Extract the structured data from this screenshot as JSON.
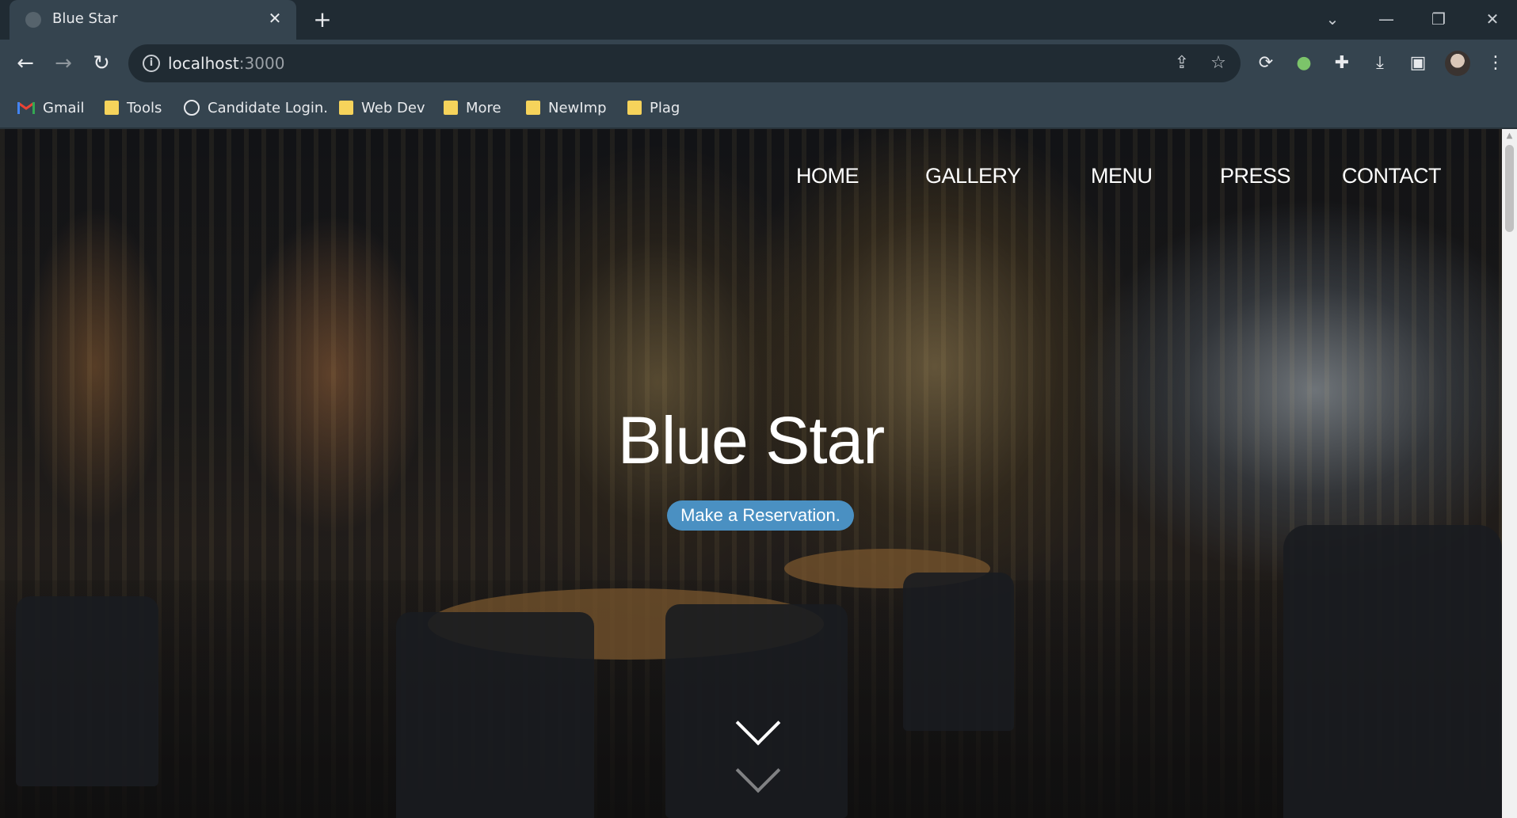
{
  "browser": {
    "tab_title": "Blue Star",
    "url_host": "localhost",
    "url_port": ":3000",
    "bookmarks": [
      {
        "label": "Gmail",
        "icon": "gmail-icon"
      },
      {
        "label": "Tools",
        "icon": "folder-icon"
      },
      {
        "label": "Candidate Login.",
        "icon": "globe-icon"
      },
      {
        "label": "Web Dev",
        "icon": "folder-icon"
      },
      {
        "label": "More",
        "icon": "folder-icon"
      },
      {
        "label": "NewImp",
        "icon": "folder-icon"
      },
      {
        "label": "Plag",
        "icon": "folder-icon"
      }
    ]
  },
  "site": {
    "nav": [
      "HOME",
      "GALLERY",
      "MENU",
      "PRESS",
      "CONTACT"
    ],
    "title": "Blue Star",
    "cta": "Make a Reservation."
  },
  "colors": {
    "accent": "#4a90c2",
    "chrome_dark": "#202b33",
    "chrome": "#35444f"
  }
}
